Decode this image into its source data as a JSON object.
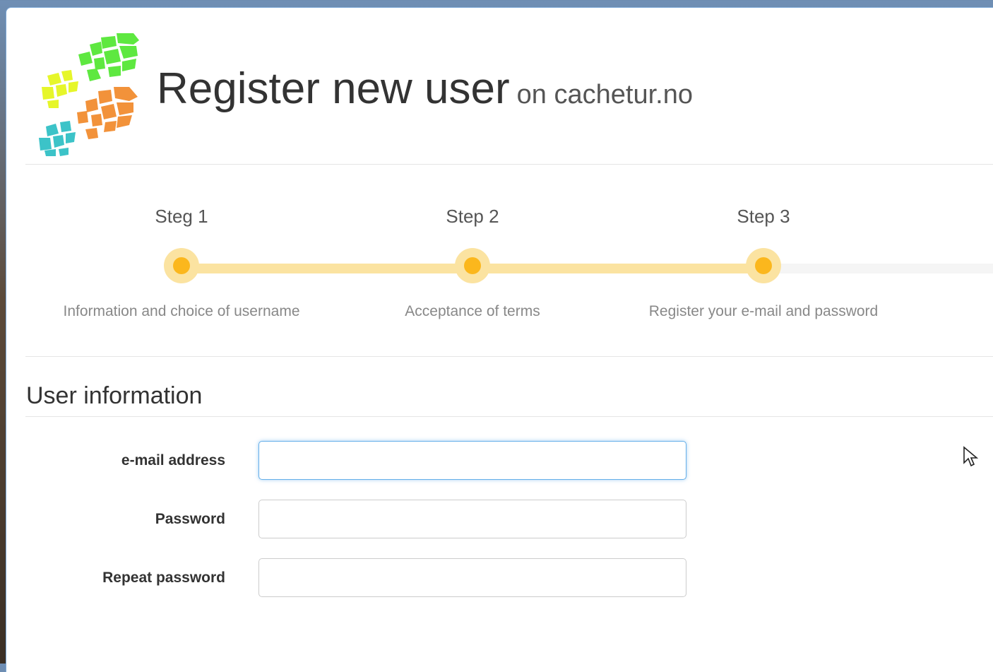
{
  "header": {
    "title": "Register new user",
    "subtitle": "on cachetur.no",
    "logo_icon": "footprints-logo-icon"
  },
  "steps": [
    {
      "label": "Steg 1",
      "description": "Information and choice of username",
      "completed": true
    },
    {
      "label": "Step 2",
      "description": "Acceptance of terms",
      "completed": true
    },
    {
      "label": "Step 3",
      "description": "Register your e-mail and password",
      "completed": true
    }
  ],
  "section": {
    "title": "User information"
  },
  "form": {
    "email_label": "e-mail address",
    "email_value": "",
    "password_label": "Password",
    "password_value": "",
    "repeat_label": "Repeat password",
    "repeat_value": ""
  },
  "colors": {
    "progress_fill": "#fbe3a1",
    "progress_dot": "#fbb71d",
    "focus_border": "#66afe9",
    "logo_green": "#5ee840",
    "logo_yellow": "#e6f62a",
    "logo_orange": "#f2923a",
    "logo_teal": "#3cc3c8"
  }
}
